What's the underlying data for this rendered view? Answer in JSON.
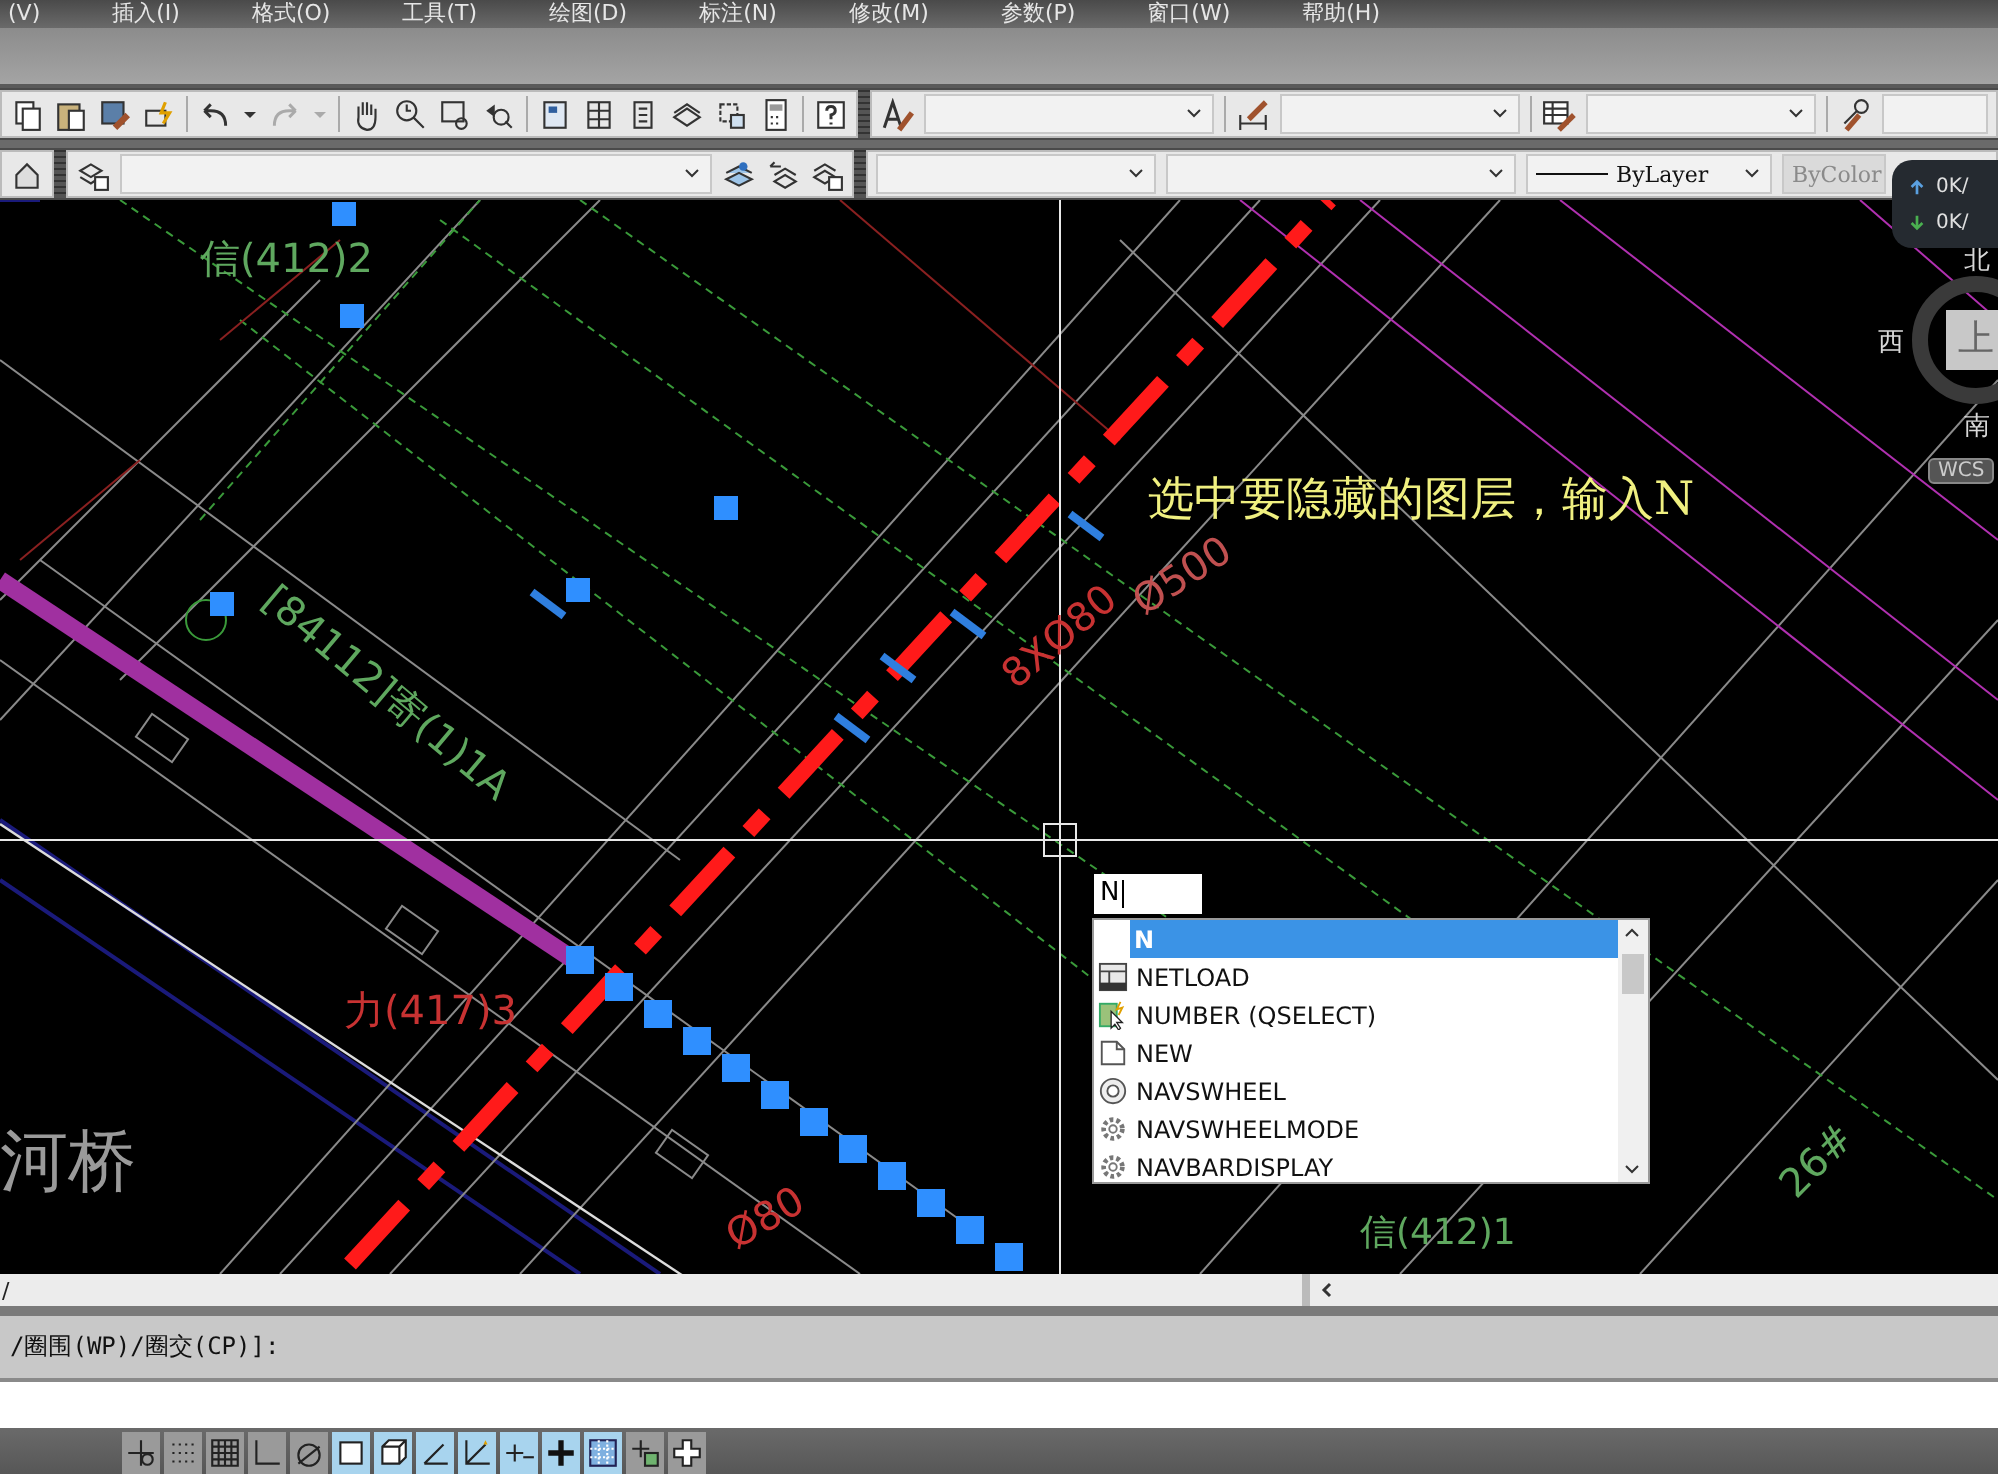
{
  "menu": [
    "(V)",
    "插入(I)",
    "格式(O)",
    "工具(T)",
    "绘图(D)",
    "标注(N)",
    "修改(M)",
    "参数(P)",
    "窗口(W)",
    "帮助(H)"
  ],
  "toolbar_2": {
    "linetype": "ByLayer",
    "plot_style": {
      "value": "ByColor",
      "disabled": true
    }
  },
  "network": {
    "upload": "0K/",
    "download": "0K/"
  },
  "viewcube": {
    "north": "北",
    "west": "西",
    "south": "南",
    "face": "上",
    "ucs": "WCS"
  },
  "drawing_labels": [
    {
      "text": "信(412)2",
      "color": "#5fa85f"
    },
    {
      "text": "[84112]寄(1)1A",
      "color": "#5fa85f"
    },
    {
      "text": "力(417)3",
      "color": "#c83232"
    },
    {
      "text": "河桥",
      "color": "#9a9a9a"
    },
    {
      "text": "Ø500",
      "color": "#c05050"
    },
    {
      "text": "8XØ80",
      "color": "#c83232"
    },
    {
      "text": "Ø80",
      "color": "#c83232"
    },
    {
      "text": "信(412)1",
      "color": "#5fa85f"
    },
    {
      "text": "26#",
      "color": "#5fa85f"
    }
  ],
  "annotation": "选中要隐藏的图层，输入N",
  "autocomplete": {
    "input": "N",
    "items": [
      {
        "label": "N",
        "kind": "none",
        "selected": true
      },
      {
        "label": "NETLOAD",
        "kind": "netload",
        "selected": false
      },
      {
        "label": "NUMBER (QSELECT)",
        "kind": "number",
        "selected": false
      },
      {
        "label": "NEW",
        "kind": "new",
        "selected": false
      },
      {
        "label": "NAVSWHEEL",
        "kind": "wheel",
        "selected": false
      },
      {
        "label": "NAVSWHEELMODE",
        "kind": "gear",
        "selected": false
      },
      {
        "label": "NAVBARDISPLAY",
        "kind": "gear",
        "selected": false
      }
    ]
  },
  "command_history": "/",
  "command_line": "/圈围(WP)/圈交(CP)]:",
  "status_toggles": [
    {
      "kind": "infer",
      "on": false
    },
    {
      "kind": "snap",
      "on": false
    },
    {
      "kind": "grid",
      "on": false
    },
    {
      "kind": "ortho",
      "on": false
    },
    {
      "kind": "polar",
      "on": false
    },
    {
      "kind": "osnap",
      "on": true
    },
    {
      "kind": "osnap3d",
      "on": true
    },
    {
      "kind": "otrack",
      "on": true
    },
    {
      "kind": "ducs",
      "on": true
    },
    {
      "kind": "dyn",
      "on": true
    },
    {
      "kind": "lwt",
      "on": true
    },
    {
      "kind": "transparency",
      "on": true
    },
    {
      "kind": "qp",
      "on": false
    },
    {
      "kind": "cycle",
      "on": false
    }
  ]
}
